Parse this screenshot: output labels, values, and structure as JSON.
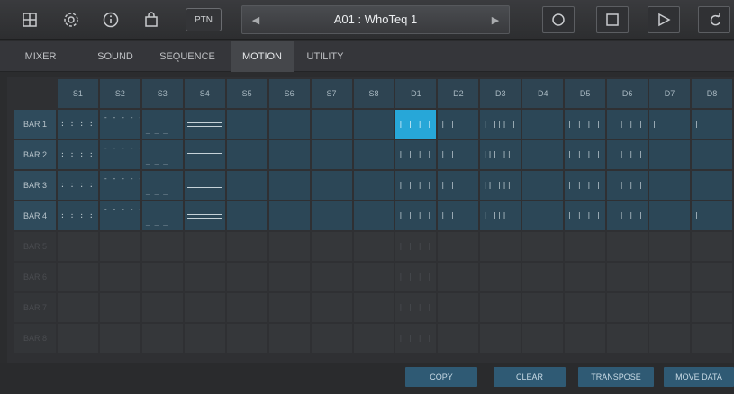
{
  "toolbar": {
    "icons": [
      "layout-icon",
      "settings-gear-icon",
      "info-icon",
      "shop-bag-icon"
    ],
    "ptn_label": "PTN",
    "pattern_name": "A01 : WhoTeq 1",
    "transport": [
      "record-icon",
      "stop-icon",
      "play-icon",
      "loop-icon"
    ]
  },
  "tabs": [
    {
      "label": "MIXER",
      "active": false
    },
    {
      "label": "SOUND",
      "active": false
    },
    {
      "label": "SEQUENCE",
      "active": false
    },
    {
      "label": "MOTION",
      "active": true
    },
    {
      "label": "UTILITY",
      "active": false
    }
  ],
  "grid": {
    "columns": [
      "S1",
      "S2",
      "S3",
      "S4",
      "S5",
      "S6",
      "S7",
      "S8",
      "D1",
      "D2",
      "D3",
      "D4",
      "D5",
      "D6",
      "D7",
      "D8"
    ],
    "rows": [
      {
        "label": "BAR 1",
        "active": true
      },
      {
        "label": "BAR 2",
        "active": true
      },
      {
        "label": "BAR 3",
        "active": true
      },
      {
        "label": "BAR 4",
        "active": true
      },
      {
        "label": "BAR 5",
        "active": false
      },
      {
        "label": "BAR 6",
        "active": false
      },
      {
        "label": "BAR 7",
        "active": false
      },
      {
        "label": "BAR 8",
        "active": false
      }
    ],
    "selected": {
      "row": 0,
      "col": 8
    }
  },
  "actions": [
    {
      "label": "COPY"
    },
    {
      "label": "CLEAR"
    },
    {
      "label": "TRANSPOSE"
    },
    {
      "label": "MOVE DATA"
    }
  ]
}
